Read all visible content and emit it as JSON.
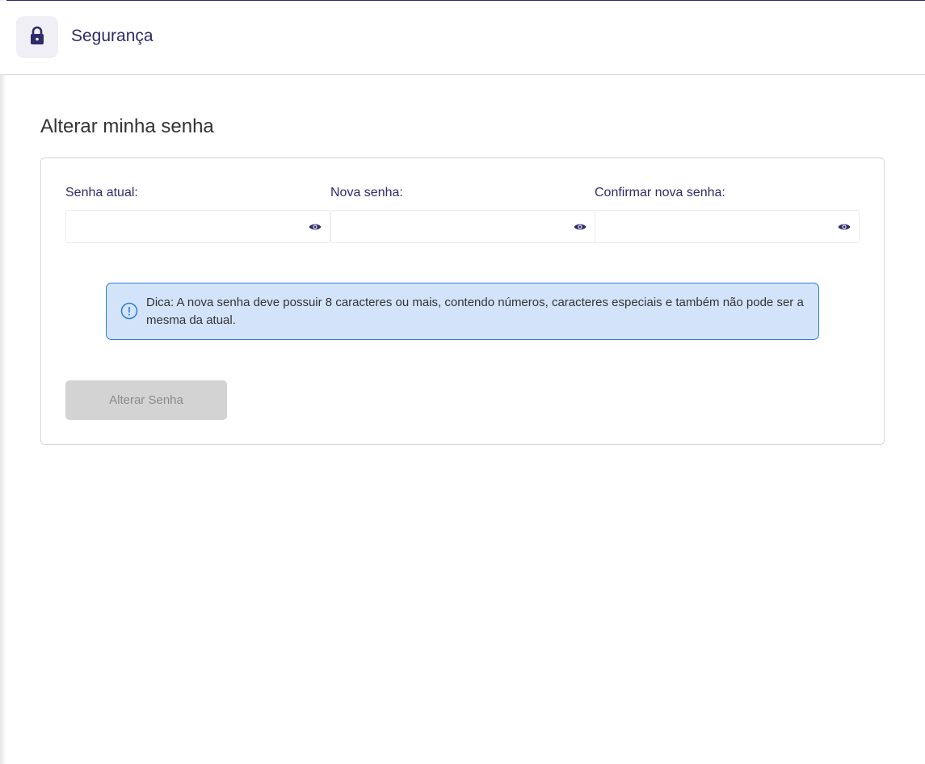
{
  "header": {
    "icon": "lock-icon",
    "title": "Segurança"
  },
  "page": {
    "title": "Alterar minha senha"
  },
  "form": {
    "fields": [
      {
        "label": "Senha atual:",
        "value": "",
        "icon": "eye-icon"
      },
      {
        "label": "Nova senha:",
        "value": "",
        "icon": "eye-icon"
      },
      {
        "label": "Confirmar nova senha:",
        "value": "",
        "icon": "eye-icon"
      }
    ],
    "tip": {
      "icon": "info-icon",
      "text": "Dica: A nova senha deve possuir 8 caracteres ou mais, contendo números, caracteres especiais e também não pode ser a mesma da atual."
    },
    "submit_label": "Alterar Senha",
    "submit_disabled": true
  },
  "colors": {
    "brand": "#2e2a6b",
    "tip_background": "#d3e4fa",
    "tip_border": "#2f7bd0",
    "disabled_button": "#d3d3d3"
  }
}
